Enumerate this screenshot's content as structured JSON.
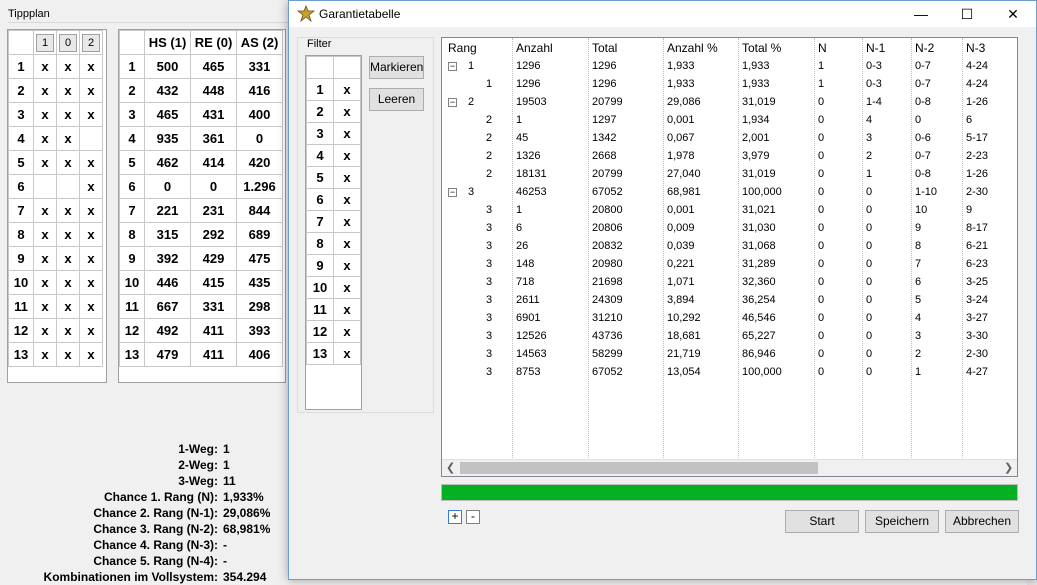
{
  "background": {
    "group_title": "Tippplan",
    "tipp_headers": [
      "1",
      "0",
      "2"
    ],
    "tipp_rows": [
      [
        "1",
        "x",
        "x",
        "x"
      ],
      [
        "2",
        "x",
        "x",
        "x"
      ],
      [
        "3",
        "x",
        "x",
        "x"
      ],
      [
        "4",
        "x",
        "x",
        ""
      ],
      [
        "5",
        "x",
        "x",
        "x"
      ],
      [
        "6",
        "",
        "",
        "x"
      ],
      [
        "7",
        "x",
        "x",
        "x"
      ],
      [
        "8",
        "x",
        "x",
        "x"
      ],
      [
        "9",
        "x",
        "x",
        "x"
      ],
      [
        "10",
        "x",
        "x",
        "x"
      ],
      [
        "11",
        "x",
        "x",
        "x"
      ],
      [
        "12",
        "x",
        "x",
        "x"
      ],
      [
        "13",
        "x",
        "x",
        "x"
      ]
    ],
    "stats_headers": [
      "HS (1)",
      "RE (0)",
      "AS (2)"
    ],
    "stats_rows": [
      [
        "1",
        "500",
        "465",
        "331"
      ],
      [
        "2",
        "432",
        "448",
        "416"
      ],
      [
        "3",
        "465",
        "431",
        "400"
      ],
      [
        "4",
        "935",
        "361",
        "0"
      ],
      [
        "5",
        "462",
        "414",
        "420"
      ],
      [
        "6",
        "0",
        "0",
        "1.296"
      ],
      [
        "7",
        "221",
        "231",
        "844"
      ],
      [
        "8",
        "315",
        "292",
        "689"
      ],
      [
        "9",
        "392",
        "429",
        "475"
      ],
      [
        "10",
        "446",
        "415",
        "435"
      ],
      [
        "11",
        "667",
        "331",
        "298"
      ],
      [
        "12",
        "492",
        "411",
        "393"
      ],
      [
        "13",
        "479",
        "411",
        "406"
      ]
    ],
    "summary": [
      {
        "label": "1-Weg:",
        "value": "1"
      },
      {
        "label": "2-Weg:",
        "value": "1"
      },
      {
        "label": "3-Weg:",
        "value": "11"
      },
      {
        "label": "Chance 1. Rang (N):",
        "value": "1,933%"
      },
      {
        "label": "Chance 2. Rang (N-1):",
        "value": "29,086%"
      },
      {
        "label": "Chance 3. Rang (N-2):",
        "value": "68,981%"
      },
      {
        "label": "Chance 4. Rang (N-3):",
        "value": "-"
      },
      {
        "label": "Chance 5. Rang (N-4):",
        "value": "-"
      },
      {
        "label": "Kombinationen im Vollsystem:",
        "value": "354.294"
      }
    ]
  },
  "dialog": {
    "title": "Garantietabelle",
    "window_buttons": {
      "minimize": "—",
      "maximize": "☐",
      "close": "✕"
    },
    "filter": {
      "label": "Filter",
      "rows": [
        [
          "1",
          "x"
        ],
        [
          "2",
          "x"
        ],
        [
          "3",
          "x"
        ],
        [
          "4",
          "x"
        ],
        [
          "5",
          "x"
        ],
        [
          "6",
          "x"
        ],
        [
          "7",
          "x"
        ],
        [
          "8",
          "x"
        ],
        [
          "9",
          "x"
        ],
        [
          "10",
          "x"
        ],
        [
          "11",
          "x"
        ],
        [
          "12",
          "x"
        ],
        [
          "13",
          "x"
        ]
      ],
      "mark_label": "Markieren",
      "clear_label": "Leeren"
    },
    "tree": {
      "columns": [
        "Rang",
        "Anzahl",
        "Total",
        "Anzahl %",
        "Total %",
        "N",
        "N-1",
        "N-2",
        "N-3"
      ],
      "rows": [
        {
          "level": 0,
          "exp": "−",
          "rang": "1",
          "cells": [
            "1296",
            "1296",
            "1,933",
            "1,933",
            "1",
            "0-3",
            "0-7",
            "4-24"
          ]
        },
        {
          "level": 1,
          "exp": "",
          "rang": "1",
          "cells": [
            "1296",
            "1296",
            "1,933",
            "1,933",
            "1",
            "0-3",
            "0-7",
            "4-24"
          ]
        },
        {
          "level": 0,
          "exp": "−",
          "rang": "2",
          "cells": [
            "19503",
            "20799",
            "29,086",
            "31,019",
            "0",
            "1-4",
            "0-8",
            "1-26"
          ]
        },
        {
          "level": 1,
          "exp": "",
          "rang": "2",
          "cells": [
            "1",
            "1297",
            "0,001",
            "1,934",
            "0",
            "4",
            "0",
            "6"
          ]
        },
        {
          "level": 1,
          "exp": "",
          "rang": "2",
          "cells": [
            "45",
            "1342",
            "0,067",
            "2,001",
            "0",
            "3",
            "0-6",
            "5-17"
          ]
        },
        {
          "level": 1,
          "exp": "",
          "rang": "2",
          "cells": [
            "1326",
            "2668",
            "1,978",
            "3,979",
            "0",
            "2",
            "0-7",
            "2-23"
          ]
        },
        {
          "level": 1,
          "exp": "",
          "rang": "2",
          "cells": [
            "18131",
            "20799",
            "27,040",
            "31,019",
            "0",
            "1",
            "0-8",
            "1-26"
          ]
        },
        {
          "level": 0,
          "exp": "−",
          "rang": "3",
          "cells": [
            "46253",
            "67052",
            "68,981",
            "100,000",
            "0",
            "0",
            "1-10",
            "2-30"
          ]
        },
        {
          "level": 1,
          "exp": "",
          "rang": "3",
          "cells": [
            "1",
            "20800",
            "0,001",
            "31,021",
            "0",
            "0",
            "10",
            "9"
          ]
        },
        {
          "level": 1,
          "exp": "",
          "rang": "3",
          "cells": [
            "6",
            "20806",
            "0,009",
            "31,030",
            "0",
            "0",
            "9",
            "8-17"
          ]
        },
        {
          "level": 1,
          "exp": "",
          "rang": "3",
          "cells": [
            "26",
            "20832",
            "0,039",
            "31,068",
            "0",
            "0",
            "8",
            "6-21"
          ]
        },
        {
          "level": 1,
          "exp": "",
          "rang": "3",
          "cells": [
            "148",
            "20980",
            "0,221",
            "31,289",
            "0",
            "0",
            "7",
            "6-23"
          ]
        },
        {
          "level": 1,
          "exp": "",
          "rang": "3",
          "cells": [
            "718",
            "21698",
            "1,071",
            "32,360",
            "0",
            "0",
            "6",
            "3-25"
          ]
        },
        {
          "level": 1,
          "exp": "",
          "rang": "3",
          "cells": [
            "2611",
            "24309",
            "3,894",
            "36,254",
            "0",
            "0",
            "5",
            "3-24"
          ]
        },
        {
          "level": 1,
          "exp": "",
          "rang": "3",
          "cells": [
            "6901",
            "31210",
            "10,292",
            "46,546",
            "0",
            "0",
            "4",
            "3-27"
          ]
        },
        {
          "level": 1,
          "exp": "",
          "rang": "3",
          "cells": [
            "12526",
            "43736",
            "18,681",
            "65,227",
            "0",
            "0",
            "3",
            "3-30"
          ]
        },
        {
          "level": 1,
          "exp": "",
          "rang": "3",
          "cells": [
            "14563",
            "58299",
            "21,719",
            "86,946",
            "0",
            "0",
            "2",
            "2-30"
          ]
        },
        {
          "level": 1,
          "exp": "",
          "rang": "3",
          "cells": [
            "8753",
            "67052",
            "13,054",
            "100,000",
            "0",
            "0",
            "1",
            "4-27"
          ]
        }
      ]
    },
    "progress_fraction": 1.0,
    "progress_color": "#06b025",
    "expand_all_label": "+",
    "collapse_all_label": "-",
    "start_label": "Start",
    "save_label": "Speichern",
    "cancel_label": "Abbrechen"
  }
}
